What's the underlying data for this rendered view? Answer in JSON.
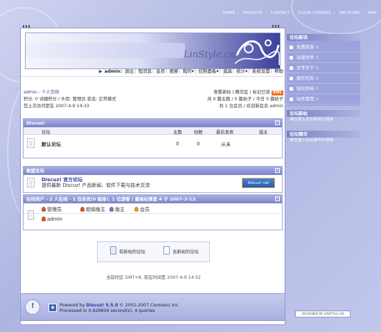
{
  "top_links": [
    "HOME",
    "FAVORITE",
    "CONTACT",
    "CLEAR COOKIES",
    "ARCHIVER",
    "WAP"
  ],
  "banner": {
    "logo_text": "LinStyle.cn"
  },
  "nav": {
    "user": "admin:",
    "items": [
      "退出",
      "短消息",
      "会员",
      "搜索",
      "我的▾",
      "控制面板▾",
      "道具",
      "统计▾",
      "系统设置",
      "帮助"
    ]
  },
  "userinfo": {
    "title": "admin - 个人空间",
    "credits_line": "积分: 0 详细积分 / 头衔: 管理员 状态: 正常模式",
    "last_visit": "您上次访问是在 2007-4-9 14:33",
    "links": "查看新帖 | 精华区 | 标记已读",
    "xml": "XML",
    "stats_line": "共 0 篇主题 / 0 篇帖子 / 今日 0 篇帖子",
    "members_line": "共 1 位会员 / 欢迎新会员 admin"
  },
  "discuz_box": {
    "title": "Discuz!",
    "headers": {
      "forum": "论坛",
      "topics": "主题",
      "posts": "帖数",
      "last": "最后发表",
      "mod": "版主"
    },
    "rows": [
      {
        "name": "默认论坛",
        "topics": "0",
        "posts": "0",
        "last": "从未"
      }
    ]
  },
  "partner_box": {
    "title": "联盟论坛",
    "name": "Discuz! 官方论坛",
    "desc": "提供最新 Discuz! 产品新闻、软件下载与技术交流",
    "logo_text": "Discuz! net"
  },
  "online_box": {
    "title": "在线用户 - 2 人在线 - 1 位会员(0 隐身), 1 位游客 | 最高纪录是 4 于 2007-3-13.",
    "legend": [
      "管理员",
      "超级版主",
      "版主",
      "会员"
    ],
    "users": [
      "admin"
    ]
  },
  "bottom": {
    "new_label": "有新帖的论坛",
    "none_label": "无新帖的论坛"
  },
  "timezone": "当前时区 GMT+8, 现在时间是 2007-4-9 14:52",
  "footer": {
    "powered": "Powered by",
    "brand": "Discuz!",
    "version": "5.5.0",
    "copyright": "© 2001-2007 Comsenz Inc.",
    "processed": "Processed in 0.929859 second(s), 4 queries",
    "designed": "DESIGNED BY LINSTYLE.CN"
  },
  "sidebar": {
    "head1": "论坛新块",
    "items": [
      "免费资源",
      "动漫世界",
      "文字天下",
      "娱乐时尚",
      "轻松休闲",
      "站务管理"
    ],
    "head2": "论坛新帖",
    "note2": "请在插入论坛新帖JS调用",
    "head3": "论坛精华",
    "note3": "请在插入论坛精华JS调用"
  },
  "colors": {
    "accent": "#7b83c6",
    "xml": "#f46a1e",
    "link": "#2f3a9b"
  }
}
